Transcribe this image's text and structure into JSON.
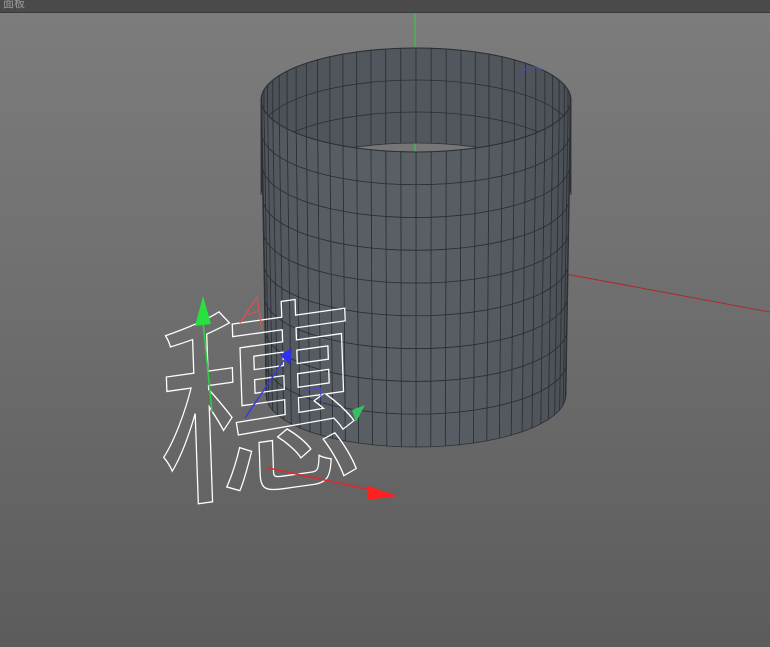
{
  "panel": {
    "title": "面板"
  },
  "viewport": {
    "object": "cylinder-mesh",
    "text_spline": "穗",
    "colors": {
      "background_top": "#7c7c7c",
      "background_bottom": "#5c5c5c",
      "mesh_fill": "#4f555c",
      "mesh_wire": "#2c3035",
      "axis_x": "#e02020",
      "axis_y": "#20d030",
      "axis_z": "#3030e0",
      "spline": "#ffffff"
    }
  }
}
